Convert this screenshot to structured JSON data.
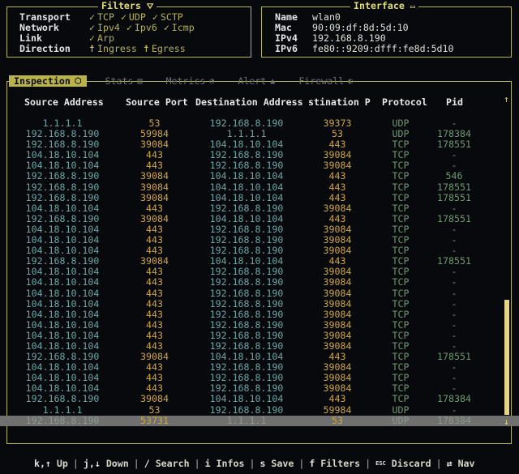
{
  "filters": {
    "title": "Filters",
    "title_icon": "funnel-x-icon",
    "rows": [
      {
        "label": "Transport",
        "items": [
          {
            "icon": "check",
            "text": "TCP"
          },
          {
            "icon": "check",
            "text": "UDP"
          },
          {
            "icon": "check",
            "text": "SCTP"
          }
        ]
      },
      {
        "label": "Network",
        "items": [
          {
            "icon": "check",
            "text": "Ipv4"
          },
          {
            "icon": "check",
            "text": "Ipv6"
          },
          {
            "icon": "check",
            "text": "Icmp"
          }
        ]
      },
      {
        "label": "Link",
        "items": [
          {
            "icon": "check",
            "text": "Arp"
          }
        ]
      },
      {
        "label": "Direction",
        "items": [
          {
            "icon": "dagger",
            "text": "Ingress"
          },
          {
            "icon": "dagger",
            "text": "Egress"
          }
        ]
      }
    ]
  },
  "interface": {
    "title": "Interface",
    "title_icon": "monitor-icon",
    "rows": [
      {
        "label": "Name",
        "value": "wlan0"
      },
      {
        "label": "Mac",
        "value": "90:09:df:8d:5d:10"
      },
      {
        "label": "IPv4",
        "value": "192.168.8.190"
      },
      {
        "label": "IPv6",
        "value": "fe80::9209:dfff:fe8d:5d10"
      }
    ]
  },
  "tabs": [
    {
      "label": "Inspection",
      "icon": "cube-icon",
      "glyph": "⬡",
      "active": true
    },
    {
      "label": "Stats",
      "icon": "bar-chart-icon",
      "glyph": "▥",
      "active": false
    },
    {
      "label": "Metrics",
      "icon": "gauge-icon",
      "glyph": "◔",
      "active": false
    },
    {
      "label": "Alert",
      "icon": "warning-icon",
      "glyph": "▲",
      "active": false
    },
    {
      "label": "Firewall",
      "icon": "shield-icon",
      "glyph": "◐",
      "active": false
    }
  ],
  "table": {
    "columns": [
      "Source Address",
      "Source Port",
      "Destination Address",
      "stination Po",
      "Protocol",
      "Pid"
    ],
    "rows": [
      [
        "1.1.1.1",
        "53",
        "192.168.8.190",
        "39373",
        "UDP",
        "-"
      ],
      [
        "192.168.8.190",
        "59984",
        "1.1.1.1",
        "53",
        "UDP",
        "178384"
      ],
      [
        "192.168.8.190",
        "39084",
        "104.18.10.104",
        "443",
        "TCP",
        "178551"
      ],
      [
        "104.18.10.104",
        "443",
        "192.168.8.190",
        "39084",
        "TCP",
        "-"
      ],
      [
        "104.18.10.104",
        "443",
        "192.168.8.190",
        "39084",
        "TCP",
        "-"
      ],
      [
        "192.168.8.190",
        "39084",
        "104.18.10.104",
        "443",
        "TCP",
        "546"
      ],
      [
        "192.168.8.190",
        "39084",
        "104.18.10.104",
        "443",
        "TCP",
        "178551"
      ],
      [
        "192.168.8.190",
        "39084",
        "104.18.10.104",
        "443",
        "TCP",
        "178551"
      ],
      [
        "104.18.10.104",
        "443",
        "192.168.8.190",
        "39084",
        "TCP",
        "-"
      ],
      [
        "192.168.8.190",
        "39084",
        "104.18.10.104",
        "443",
        "TCP",
        "178551"
      ],
      [
        "104.18.10.104",
        "443",
        "192.168.8.190",
        "39084",
        "TCP",
        "-"
      ],
      [
        "104.18.10.104",
        "443",
        "192.168.8.190",
        "39084",
        "TCP",
        "-"
      ],
      [
        "104.18.10.104",
        "443",
        "192.168.8.190",
        "39084",
        "TCP",
        "-"
      ],
      [
        "192.168.8.190",
        "39084",
        "104.18.10.104",
        "443",
        "TCP",
        "178551"
      ],
      [
        "104.18.10.104",
        "443",
        "192.168.8.190",
        "39084",
        "TCP",
        "-"
      ],
      [
        "104.18.10.104",
        "443",
        "192.168.8.190",
        "39084",
        "TCP",
        "-"
      ],
      [
        "104.18.10.104",
        "443",
        "192.168.8.190",
        "39084",
        "TCP",
        "-"
      ],
      [
        "104.18.10.104",
        "443",
        "192.168.8.190",
        "39084",
        "TCP",
        "-"
      ],
      [
        "104.18.10.104",
        "443",
        "192.168.8.190",
        "39084",
        "TCP",
        "-"
      ],
      [
        "104.18.10.104",
        "443",
        "192.168.8.190",
        "39084",
        "TCP",
        "-"
      ],
      [
        "104.18.10.104",
        "443",
        "192.168.8.190",
        "39084",
        "TCP",
        "-"
      ],
      [
        "104.18.10.104",
        "443",
        "192.168.8.190",
        "39084",
        "TCP",
        "-"
      ],
      [
        "192.168.8.190",
        "39084",
        "104.18.10.104",
        "443",
        "TCP",
        "178551"
      ],
      [
        "104.18.10.104",
        "443",
        "192.168.8.190",
        "39084",
        "TCP",
        "-"
      ],
      [
        "104.18.10.104",
        "443",
        "192.168.8.190",
        "39084",
        "TCP",
        "-"
      ],
      [
        "104.18.10.104",
        "443",
        "192.168.8.190",
        "39084",
        "TCP",
        "-"
      ],
      [
        "192.168.8.190",
        "39084",
        "104.18.10.104",
        "443",
        "TCP",
        "178384"
      ],
      [
        "1.1.1.1",
        "53",
        "192.168.8.190",
        "59984",
        "UDP",
        "-"
      ],
      [
        "192.168.8.190",
        "53731",
        "1.1.1.1",
        "53",
        "UDP",
        "178384"
      ]
    ],
    "selected_row": 28
  },
  "scrollbar": {
    "up_glyph": "↑",
    "down_glyph": "↓"
  },
  "help": [
    {
      "key": "k,↑",
      "action": "Up"
    },
    {
      "key": "j,↓",
      "action": "Down"
    },
    {
      "key": "/",
      "action": "Search"
    },
    {
      "key": "i",
      "action": "Infos"
    },
    {
      "key": "s",
      "action": "Save"
    },
    {
      "key": "f",
      "action": "Filters"
    },
    {
      "key": "ESC",
      "action": "Discard"
    },
    {
      "key": "⇄",
      "action": "Nav"
    }
  ]
}
